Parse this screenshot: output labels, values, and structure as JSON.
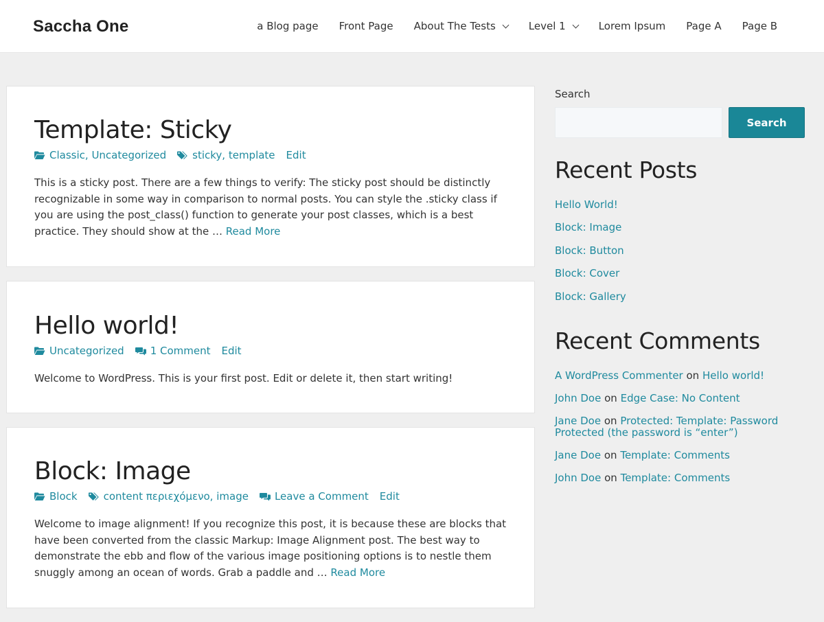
{
  "header": {
    "site_title": "Saccha One",
    "nav": [
      {
        "label": "a Blog page",
        "has_dropdown": false
      },
      {
        "label": "Front Page",
        "has_dropdown": false
      },
      {
        "label": "About The Tests",
        "has_dropdown": true
      },
      {
        "label": "Level 1",
        "has_dropdown": true
      },
      {
        "label": "Lorem Ipsum",
        "has_dropdown": false
      },
      {
        "label": "Page A",
        "has_dropdown": false
      },
      {
        "label": "Page B",
        "has_dropdown": false
      }
    ]
  },
  "posts": [
    {
      "title": "Template: Sticky",
      "categories": [
        "Classic",
        "Uncategorized"
      ],
      "tags": [
        "sticky",
        "template"
      ],
      "edit": "Edit",
      "excerpt": "This is a sticky post. There are a few things to verify: The sticky post should be distinctly recognizable in some way in comparison to normal posts. You can style the .sticky class if you are using the post_class() function to generate your post classes, which is a best practice. They should show at the …",
      "read_more": "Read More"
    },
    {
      "title": "Hello world!",
      "categories": [
        "Uncategorized"
      ],
      "comments": "1 Comment",
      "edit": "Edit",
      "excerpt": "Welcome to WordPress. This is your first post. Edit or delete it, then start writing!"
    },
    {
      "title": "Block: Image",
      "categories": [
        "Block"
      ],
      "tags": [
        "content περιεχόμενο",
        "image"
      ],
      "comments": "Leave a Comment",
      "edit": "Edit",
      "excerpt": "Welcome to image alignment! If you recognize this post, it is because these are blocks that have been converted from the classic Markup: Image Alignment post. The best way to demonstrate the ebb and flow of the various image positioning options is to nestle them snuggly among an ocean of words. Grab a paddle and …",
      "read_more": "Read More"
    }
  ],
  "sidebar": {
    "search_label": "Search",
    "search_placeholder": "",
    "search_button": "Search",
    "recent_posts_title": "Recent Posts",
    "recent_posts": [
      "Hello World!",
      "Block: Image",
      "Block: Button",
      "Block: Cover",
      "Block: Gallery"
    ],
    "recent_comments_title": "Recent Comments",
    "on_word": "on",
    "recent_comments": [
      {
        "author": "A WordPress Commenter",
        "post": "Hello world!"
      },
      {
        "author": "John Doe",
        "post": "Edge Case: No Content"
      },
      {
        "author": "Jane Doe",
        "post": "Protected: Template: Password Protected (the password is “enter”)"
      },
      {
        "author": "Jane Doe",
        "post": "Template: Comments"
      },
      {
        "author": "John Doe",
        "post": "Template: Comments"
      }
    ]
  },
  "colors": {
    "accent": "#1f8a9e",
    "button": "#1a8797",
    "background": "#efefef"
  }
}
